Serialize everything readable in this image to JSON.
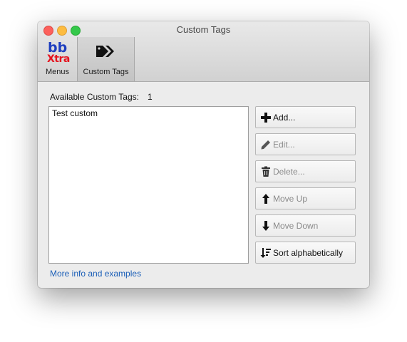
{
  "window": {
    "title": "Custom Tags"
  },
  "toolbar": {
    "items": [
      {
        "label": "Menus",
        "icon": "bbxtra-logo-icon",
        "logo_text_top": "bb",
        "logo_text_bottom": "Xtra"
      },
      {
        "label": "Custom Tags",
        "icon": "tags-icon",
        "selected": true
      }
    ]
  },
  "main": {
    "available_label": "Available Custom Tags:",
    "available_count": "1",
    "list_items": [
      "Test custom"
    ],
    "buttons": [
      {
        "label": "Add...",
        "icon": "plus-icon",
        "enabled": true
      },
      {
        "label": "Edit...",
        "icon": "pencil-icon",
        "enabled": false
      },
      {
        "label": "Delete...",
        "icon": "trash-icon",
        "enabled": false
      },
      {
        "label": "Move Up",
        "icon": "arrow-up-icon",
        "enabled": false
      },
      {
        "label": "Move Down",
        "icon": "arrow-down-icon",
        "enabled": false
      },
      {
        "label": "Sort alphabetically",
        "icon": "sort-icon",
        "enabled": true
      }
    ],
    "more_info_link": "More info and examples"
  },
  "colors": {
    "link": "#1a5eb7",
    "close": "#fc605c",
    "minimize": "#fdbc40",
    "zoom": "#34c84a"
  }
}
